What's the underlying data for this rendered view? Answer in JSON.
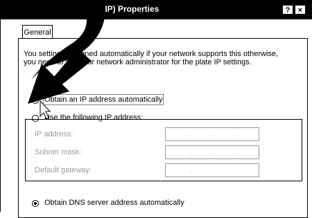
{
  "window": {
    "title": "/IP) Properties",
    "help_label": "?",
    "close_label": "×"
  },
  "tabs": [
    {
      "label": "General"
    }
  ],
  "description": "You settings assigned automatically if your network supports this otherwise, you need to ask your network administrator for the plate IP settings.",
  "ip_options": {
    "auto_label": "Obtain an IP address automatically",
    "manual_label": "Use the following IP address:",
    "selected": "auto"
  },
  "fields": [
    {
      "label": "IP address:",
      "value": ". . ."
    },
    {
      "label": "Subnet mask:",
      "value": ". . ."
    },
    {
      "label": "Default gateway:",
      "value": ". . ."
    }
  ],
  "dns_options": {
    "auto_label": "Obtain DNS server address automatically",
    "selected": "auto"
  },
  "icons": [
    "annotation-arrow-icon",
    "cursor-pointer-icon"
  ]
}
